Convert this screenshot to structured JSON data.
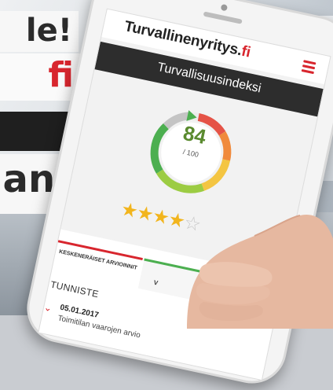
{
  "banner": {
    "line1": "le!",
    "line2": "fi",
    "line3": "an!"
  },
  "site": {
    "brand_name": "Turvallinenyritys.",
    "brand_tld": "fi",
    "menu_icon": "hamburger-menu-icon",
    "page_title": "Turvallisuusindeksi"
  },
  "score": {
    "value": "84",
    "max_label": "/ 100",
    "gauge_fraction": 0.84,
    "stars_filled": 4,
    "stars_total": 5
  },
  "tabs": {
    "tab1_label": "KESKENERÄISET ARVIOINNIT",
    "tab2_label": "V"
  },
  "table": {
    "column_header": "TUNNISTE",
    "rows": [
      {
        "date": "05.01.2017",
        "text": "Toimitilan vaarojen arvio"
      }
    ]
  },
  "colors": {
    "brand_red": "#d8262e",
    "header_dark": "#2d2d2d",
    "score_green": "#5a8a2f",
    "star_yellow": "#f2b51d"
  }
}
